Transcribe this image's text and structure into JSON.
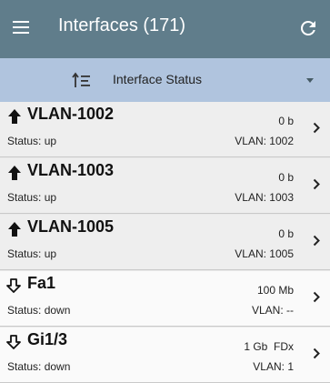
{
  "appbar": {
    "title": "Interfaces (171)"
  },
  "sortbar": {
    "label": "Interface Status"
  },
  "rows": [
    {
      "name": "VLAN-1002",
      "status": "Status: up",
      "rate": "0 b",
      "vlan": "VLAN: 1002",
      "direction": "up"
    },
    {
      "name": "VLAN-1003",
      "status": "Status: up",
      "rate": "0 b",
      "vlan": "VLAN: 1003",
      "direction": "up"
    },
    {
      "name": "VLAN-1005",
      "status": "Status: up",
      "rate": "0 b",
      "vlan": "VLAN: 1005",
      "direction": "up"
    },
    {
      "name": "Fa1",
      "status": "Status: down",
      "rate": "100 Mb",
      "vlan": "VLAN: --",
      "direction": "down"
    },
    {
      "name": "Gi1/3",
      "status": "Status: down",
      "rate": "1 Gb  FDx",
      "vlan": "VLAN: 1",
      "direction": "down"
    }
  ],
  "colors": {
    "appbar": "#607d8b",
    "sortbar": "#b0c4de"
  }
}
